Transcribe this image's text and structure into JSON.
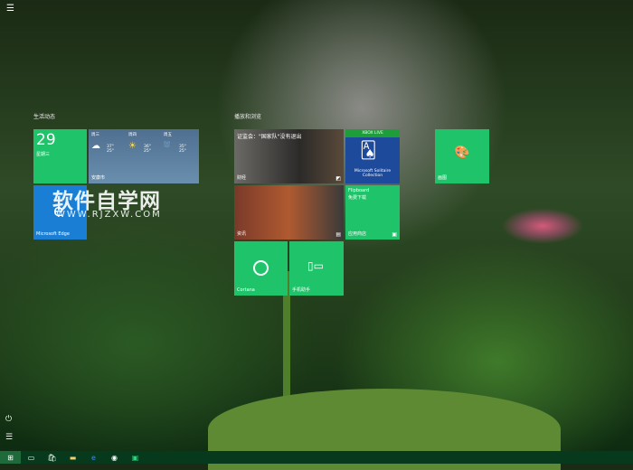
{
  "groups": [
    {
      "title": "生活动态"
    },
    {
      "title": "播放和浏览"
    }
  ],
  "calendar": {
    "day": "29",
    "weekday": "星期三"
  },
  "weather": {
    "city": "安康市",
    "days": [
      {
        "name": "周三",
        "high": "37°",
        "low": "25°"
      },
      {
        "name": "周四",
        "high": "36°",
        "low": "25°"
      },
      {
        "name": "周五",
        "high": "35°",
        "low": "25°"
      }
    ]
  },
  "edge": {
    "label": "Microsoft Edge"
  },
  "money": {
    "headline": "证监会：\"国家队\"没有退出",
    "label": "财经"
  },
  "news": {
    "label": "资讯"
  },
  "solitaire": {
    "badge": "XBOX LIVE",
    "title": "Microsoft Solitaire Collection"
  },
  "flipboard": {
    "title": "Flipboard",
    "subtitle": "免费下载",
    "label": "应用商店"
  },
  "cortana": {
    "label": "Cortana"
  },
  "phone": {
    "label": "手机助手"
  },
  "paint": {
    "label": "画图"
  },
  "watermark": {
    "title": "软件自学网",
    "url": "WWW.RJZXW.COM"
  },
  "colors": {
    "tile": "#1fc46a",
    "edge": "#1a7fd4",
    "taskbar": "#073a1c"
  }
}
